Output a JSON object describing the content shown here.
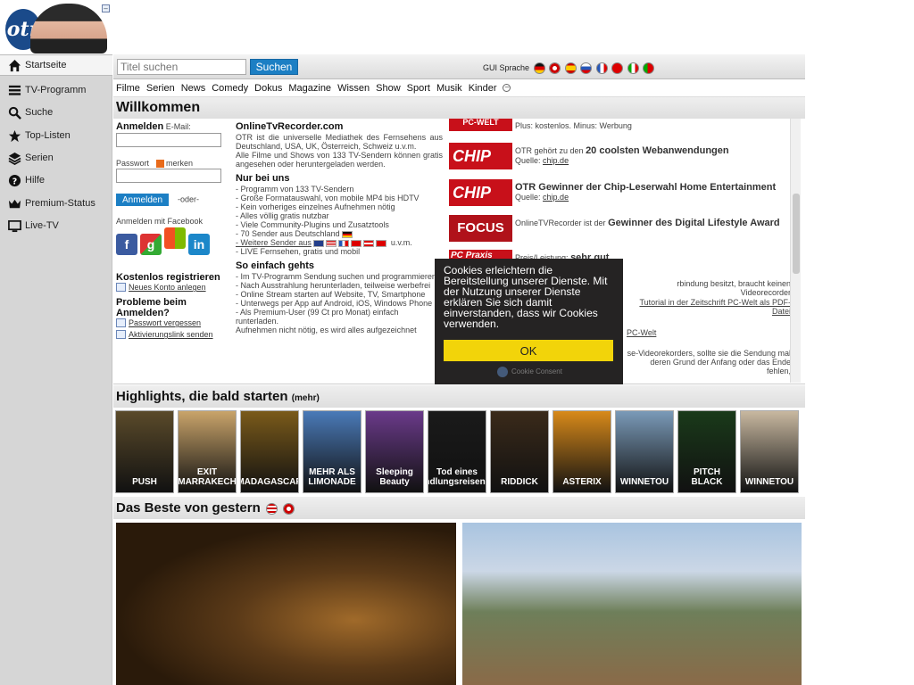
{
  "header": {
    "logo_text": "otr"
  },
  "sidebar": {
    "items": [
      {
        "label": "Startseite",
        "icon": "home-icon"
      },
      {
        "label": "TV-Programm",
        "icon": "list-icon"
      },
      {
        "label": "Suche",
        "icon": "search-icon"
      },
      {
        "label": "Top-Listen",
        "icon": "star-icon"
      },
      {
        "label": "Serien",
        "icon": "layers-icon"
      },
      {
        "label": "Hilfe",
        "icon": "help-icon"
      },
      {
        "label": "Premium-Status",
        "icon": "crown-icon"
      },
      {
        "label": "Live-TV",
        "icon": "monitor-icon"
      }
    ]
  },
  "search": {
    "placeholder": "Titel suchen",
    "button_label": "Suchen"
  },
  "gui_lang": {
    "label": "GUI Sprache",
    "flags": [
      "de",
      "gb",
      "es",
      "ru",
      "fr",
      "tr",
      "it",
      "pt"
    ]
  },
  "categories": [
    "Filme",
    "Serien",
    "News",
    "Comedy",
    "Dokus",
    "Magazine",
    "Wissen",
    "Show",
    "Sport",
    "Musik",
    "Kinder"
  ],
  "welcome": {
    "title": "Willkommen",
    "login": {
      "heading": "Anmelden",
      "email_label": "E-Mail:",
      "password_label": "Passwort",
      "remember_label": "merken",
      "button_label": "Anmelden",
      "or_label": "-oder-",
      "facebook_label": "Anmelden mit Facebook",
      "register_heading": "Kostenlos registrieren",
      "register_link": "Neues Konto anlegen",
      "problems_heading": "Probleme beim Anmelden?",
      "forgot_link": "Passwort vergessen",
      "activation_link": "Aktivierungslink senden"
    },
    "info": {
      "heading": "OnlineTvRecorder.com",
      "intro1": "OTR ist die universelle Mediathek des Fernsehens aus Deutschland, USA, UK, Österreich, Schweiz u.v.m.",
      "intro2": "Alle Filme und Shows von 133 TV-Sendern können gratis angesehen oder heruntergeladen werden.",
      "only_heading": "Nur bei uns",
      "only_items": [
        "- Programm von 133 TV-Sendern",
        "- Große Formatauswahl, von mobile MP4 bis HDTV",
        "- Kein vorheriges einzelnes Aufnehmen nötig",
        "- Alles völlig gratis nutzbar",
        "- Viele Community-Plugins und Zusatztools",
        "- 70 Sender aus Deutschland",
        "- Weitere Sender aus",
        "- LIVE Fernsehen, gratis und mobil"
      ],
      "more_suffix": "u.v.m.",
      "easy_heading": "So einfach gehts",
      "easy_items": [
        "- Im TV-Programm Sendung suchen und programmieren",
        "- Nach Ausstrahlung herunterladen, teilweise werbefrei",
        "- Online Stream starten auf Website, TV, Smartphone",
        "- Unterwegs per App auf Android, iOS, Windows Phone",
        "- Als Premium-User (99 Ct pro Monat) einfach runterladen.",
        "Aufnehmen nicht nötig, es wird alles aufgezeichnet"
      ]
    },
    "press": [
      {
        "logo": "PC-WELT",
        "text": "Plus: kostenlos. Minus: Werbung",
        "bold": "",
        "source": ""
      },
      {
        "logo": "CHIP",
        "text": "OTR gehört zu den",
        "bold": "20 coolsten Webanwendungen",
        "source_label": "Quelle:",
        "source": "chip.de"
      },
      {
        "logo": "CHIP",
        "text": "",
        "bold": "OTR Gewinner der Chip-Leserwahl Home Entertainment",
        "source_label": "Quelle:",
        "source": "chip.de"
      },
      {
        "logo": "FOCUS",
        "text": "OnlineTVRecorder ist der",
        "bold": "Gewinner des Digital Lifestyle Award",
        "source": ""
      },
      {
        "logo": "PC Praxis",
        "text": "Preis/Leistung:",
        "bold": "sehr gut",
        "source": ""
      }
    ],
    "press_fragments": [
      "rbindung besitzt, braucht keinen Videorecorder",
      "Tutorial in der Zeitschrift PC-Welt als PDF-Datei",
      "PC-Welt",
      "se-Videorekorders, sollte sie die Sendung mal",
      "deren Grund der Anfang oder das Ende fehlen,"
    ]
  },
  "cookie": {
    "text": "Cookies erleichtern die Bereitstellung unserer Dienste. Mit der Nutzung unserer Dienste erklären Sie sich damit einverstanden, dass wir Cookies verwenden.",
    "ok_label": "OK",
    "brand": "Cookie Consent"
  },
  "highlights": {
    "title": "Highlights, die bald starten",
    "more": "(mehr)",
    "posters": [
      {
        "title": "PUSH",
        "color": "#5a4a2a"
      },
      {
        "title": "EXIT MARRAKECH",
        "color": "#c9a46a"
      },
      {
        "title": "MADAGASCAR",
        "color": "#7a5a1a"
      },
      {
        "title": "MEHR ALS LIMONADE",
        "color": "#4a7ab8"
      },
      {
        "title": "Sleeping Beauty",
        "color": "#6a3a8a"
      },
      {
        "title": "Tod eines Handlungsreisenden",
        "color": "#1a1a1a"
      },
      {
        "title": "RIDDICK",
        "color": "#3a2a1a"
      },
      {
        "title": "ASTERIX",
        "color": "#d88a1a"
      },
      {
        "title": "WINNETOU",
        "color": "#7a9ab8"
      },
      {
        "title": "PITCH BLACK",
        "color": "#1a3a1a"
      },
      {
        "title": "WINNETOU",
        "color": "#c8b8a0"
      }
    ]
  },
  "beste": {
    "title": "Das Beste von gestern"
  }
}
